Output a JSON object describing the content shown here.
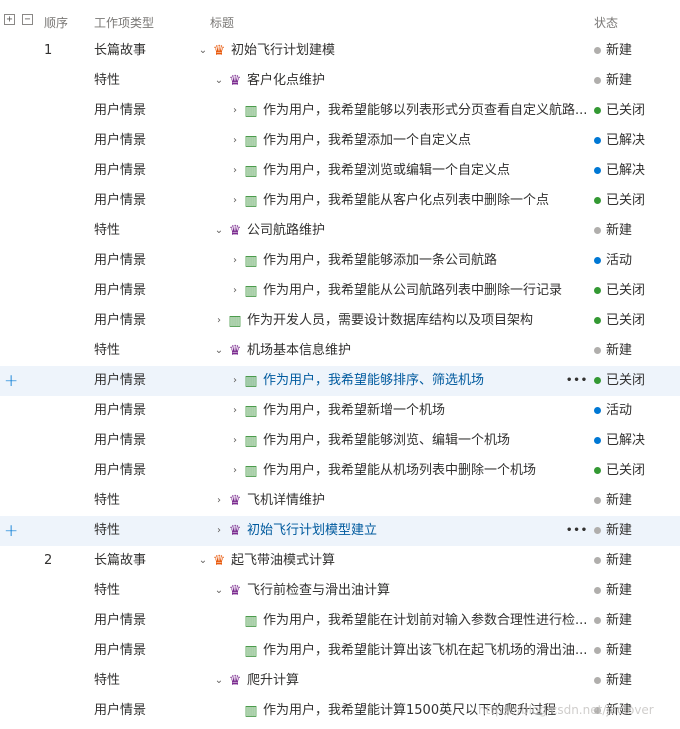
{
  "header": {
    "expand_icon": "plus-square-icon",
    "collapse_icon": "minus-square-icon",
    "order": "顺序",
    "type": "工作项类型",
    "title": "标题",
    "state": "状态"
  },
  "colors": {
    "new": "#b0aeac",
    "closed": "#339933",
    "resolved": "#0078d4",
    "active": "#0078d4"
  },
  "rows": [
    {
      "order": "1",
      "type": "长篇故事",
      "level": 0,
      "expanded": true,
      "icon": "crown-icon",
      "title": "初始飞行计划建模",
      "state": "新建",
      "state_color": "new"
    },
    {
      "order": "",
      "type": "特性",
      "level": 1,
      "expanded": true,
      "icon": "trophy-icon",
      "title": "客户化点维护",
      "state": "新建",
      "state_color": "new"
    },
    {
      "order": "",
      "type": "用户情景",
      "level": 2,
      "expanded": false,
      "icon": "story-icon",
      "title": "作为用户，我希望能够以列表形式分页查看自定义航路...",
      "state": "已关闭",
      "state_color": "closed"
    },
    {
      "order": "",
      "type": "用户情景",
      "level": 2,
      "expanded": false,
      "icon": "story-icon",
      "title": "作为用户，我希望添加一个自定义点",
      "state": "已解决",
      "state_color": "resolved"
    },
    {
      "order": "",
      "type": "用户情景",
      "level": 2,
      "expanded": false,
      "icon": "story-icon",
      "title": "作为用户，我希望浏览或编辑一个自定义点",
      "state": "已解决",
      "state_color": "resolved"
    },
    {
      "order": "",
      "type": "用户情景",
      "level": 2,
      "expanded": false,
      "icon": "story-icon",
      "title": "作为用户，我希望能从客户化点列表中删除一个点",
      "state": "已关闭",
      "state_color": "closed"
    },
    {
      "order": "",
      "type": "特性",
      "level": 1,
      "expanded": true,
      "icon": "trophy-icon",
      "title": "公司航路维护",
      "state": "新建",
      "state_color": "new"
    },
    {
      "order": "",
      "type": "用户情景",
      "level": 2,
      "expanded": false,
      "icon": "story-icon",
      "title": "作为用户，我希望能够添加一条公司航路",
      "state": "活动",
      "state_color": "active"
    },
    {
      "order": "",
      "type": "用户情景",
      "level": 2,
      "expanded": false,
      "icon": "story-icon",
      "title": "作为用户，我希望能从公司航路列表中删除一行记录",
      "state": "已关闭",
      "state_color": "closed"
    },
    {
      "order": "",
      "type": "用户情景",
      "level": 1,
      "expanded": false,
      "icon": "story-icon",
      "title": "作为开发人员，需要设计数据库结构以及项目架构",
      "state": "已关闭",
      "state_color": "closed"
    },
    {
      "order": "",
      "type": "特性",
      "level": 1,
      "expanded": true,
      "icon": "trophy-icon",
      "title": "机场基本信息维护",
      "state": "新建",
      "state_color": "new"
    },
    {
      "order": "",
      "type": "用户情景",
      "level": 2,
      "expanded": false,
      "icon": "story-icon",
      "title": "作为用户，我希望能够排序、筛选机场",
      "state": "已关闭",
      "state_color": "closed",
      "highlight": true
    },
    {
      "order": "",
      "type": "用户情景",
      "level": 2,
      "expanded": false,
      "icon": "story-icon",
      "title": "作为用户，我希望新增一个机场",
      "state": "活动",
      "state_color": "active"
    },
    {
      "order": "",
      "type": "用户情景",
      "level": 2,
      "expanded": false,
      "icon": "story-icon",
      "title": "作为用户，我希望能够浏览、编辑一个机场",
      "state": "已解决",
      "state_color": "resolved"
    },
    {
      "order": "",
      "type": "用户情景",
      "level": 2,
      "expanded": false,
      "icon": "story-icon",
      "title": "作为用户，我希望能从机场列表中删除一个机场",
      "state": "已关闭",
      "state_color": "closed"
    },
    {
      "order": "",
      "type": "特性",
      "level": 1,
      "expanded": false,
      "icon": "trophy-icon",
      "title": "飞机详情维护",
      "state": "新建",
      "state_color": "new"
    },
    {
      "order": "",
      "type": "特性",
      "level": 1,
      "expanded": false,
      "icon": "trophy-icon",
      "title": "初始飞行计划模型建立",
      "state": "新建",
      "state_color": "new",
      "highlight": true
    },
    {
      "order": "2",
      "type": "长篇故事",
      "level": 0,
      "expanded": true,
      "icon": "crown-icon",
      "title": "起飞带油模式计算",
      "state": "新建",
      "state_color": "new"
    },
    {
      "order": "",
      "type": "特性",
      "level": 1,
      "expanded": true,
      "icon": "trophy-icon",
      "title": "飞行前检查与滑出油计算",
      "state": "新建",
      "state_color": "new"
    },
    {
      "order": "",
      "type": "用户情景",
      "level": 2,
      "expanded": null,
      "icon": "story-icon",
      "title": "作为用户，我希望能在计划前对输入参数合理性进行检...",
      "state": "新建",
      "state_color": "new"
    },
    {
      "order": "",
      "type": "用户情景",
      "level": 2,
      "expanded": null,
      "icon": "story-icon",
      "title": "作为用户，我希望能计算出该飞机在起飞机场的滑出油...",
      "state": "新建",
      "state_color": "new"
    },
    {
      "order": "",
      "type": "特性",
      "level": 1,
      "expanded": true,
      "icon": "trophy-icon",
      "title": "爬升计算",
      "state": "新建",
      "state_color": "new"
    },
    {
      "order": "",
      "type": "用户情景",
      "level": 2,
      "expanded": null,
      "icon": "story-icon",
      "title": "作为用户，我希望能计算1500英尺以下的爬升过程",
      "state": "新建",
      "state_color": "new"
    }
  ],
  "row_actions": {
    "add_icon": "plus-icon",
    "more_icon": "more-icon"
  },
  "watermark": "https://blog.csdn.net/jaclover"
}
